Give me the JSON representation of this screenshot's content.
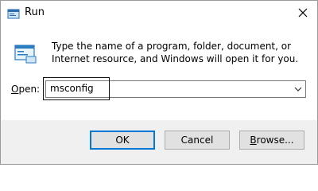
{
  "window": {
    "title": "Run",
    "icon": "run-icon"
  },
  "description": "Type the name of a program, folder, document, or Internet resource, and Windows will open it for you.",
  "open_field": {
    "label": "Open:",
    "value": "msconfig"
  },
  "buttons": {
    "ok": "OK",
    "cancel": "Cancel",
    "browse": "Browse..."
  },
  "colors": {
    "accent": "#0078d7",
    "button_bg": "#e1e1e1",
    "footer_bg": "#f0f0f0"
  }
}
